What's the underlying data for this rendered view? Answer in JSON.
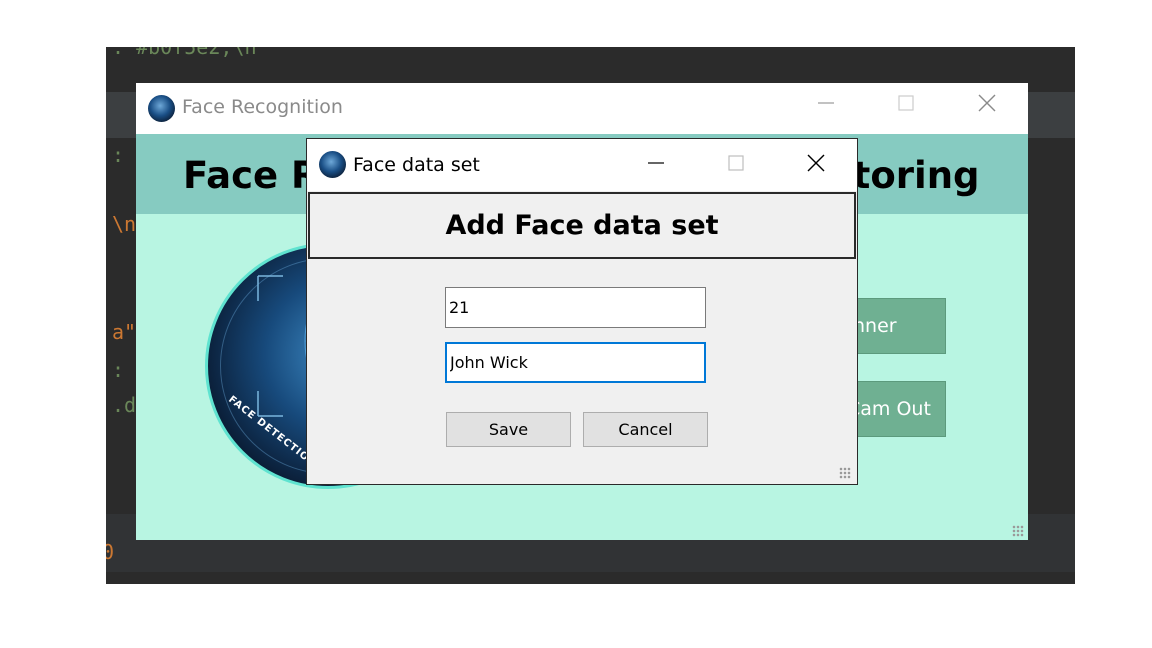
{
  "background_editor": {
    "lines": [
      ": #b0f5e2,\\n",
      ":",
      "\\n",
      "a\"",
      ":",
      ".d",
      "0"
    ]
  },
  "main_window": {
    "title": "Face Recognition",
    "header_left": "Face R",
    "header_right": "itoring",
    "logo_text": "FACE DETECTION IN",
    "button_scanner_partial": "nner",
    "button_camout_partial": "Cam Out"
  },
  "dialog": {
    "title": "Face data set",
    "heading": "Add Face data set",
    "id_field": {
      "value": "21"
    },
    "name_field": {
      "value": "John Wick"
    },
    "save_label": "Save",
    "cancel_label": "Cancel"
  },
  "icons": {
    "app_icon": "app-logo-icon",
    "minimize": "minimize-icon",
    "maximize": "maximize-icon",
    "close": "close-icon",
    "resize": "resize-grip-icon"
  },
  "colors": {
    "app_background": "#b8f5e2",
    "header_background": "#86cbc1",
    "accent_button": "#6fb092",
    "focus_border": "#0078d7"
  }
}
